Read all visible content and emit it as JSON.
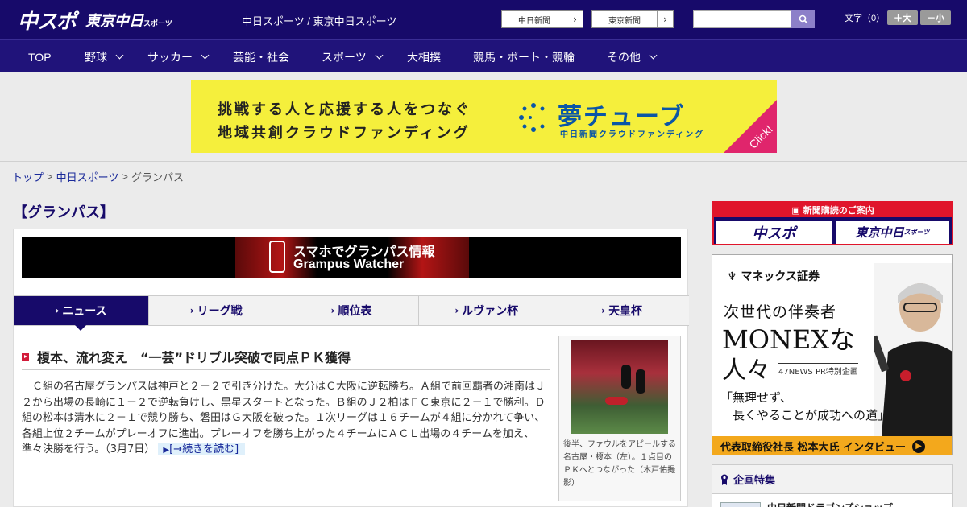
{
  "header": {
    "logo_main": "中スポ",
    "logo_tokyo": "東京中日",
    "logo_tokyo_sub": "スポーツ",
    "site_title": "中日スポーツ / 東京中日スポーツ",
    "links": [
      {
        "label": "中日新聞"
      },
      {
        "label": "東京新聞"
      }
    ],
    "search_placeholder": "",
    "font_size_label": "文字（0）",
    "font_bigger": "＋大",
    "font_smaller": "－小"
  },
  "nav": {
    "items": [
      {
        "label": "TOP"
      },
      {
        "label": "野球"
      },
      {
        "label": "サッカー"
      },
      {
        "label": "芸能・社会"
      },
      {
        "label": "スポーツ"
      },
      {
        "label": "大相撲"
      },
      {
        "label": "競馬・ボート・競輪"
      },
      {
        "label": "その他"
      }
    ]
  },
  "banner": {
    "line1": "挑戦する人と応援する人をつなぐ",
    "line2": "地域共創クラウドファンディング",
    "brand": "夢チューブ",
    "brand_sub": "中日新聞クラウドファンディング",
    "click": "Click!",
    "color": "#f5ef3c"
  },
  "breadcrumb": {
    "items": [
      "トップ",
      "中日スポーツ",
      "グランパス"
    ],
    "sep": ">"
  },
  "page": {
    "title": "【グランパス】",
    "watcher_line1": "スマホでグランパス情報",
    "watcher_line2": "Grampus Watcher"
  },
  "tabs": [
    {
      "label": "ニュース",
      "active": true
    },
    {
      "label": "リーグ戦"
    },
    {
      "label": "順位表"
    },
    {
      "label": "ルヴァン杯"
    },
    {
      "label": "天皇杯"
    }
  ],
  "article": {
    "headline": "榎本、流れ変え　“一芸”ドリブル突破で同点ＰＫ獲得",
    "body": "Ｃ組の名古屋グランパスは神戸と２－２で引き分けた。大分はＣ大阪に逆転勝ち。Ａ組で前回覇者の湘南はＪ２から出場の長崎に１－２で逆転負けし、黒星スタートとなった。Ｂ組のＪ２柏はＦＣ東京に２－１で勝利。Ｄ組の松本は清水に２－１で競り勝ち、磐田はＧ大阪を破った。１次リーグは１６チームが４組に分かれて争い、各組上位２チームがプレーオフに進出。プレーオフを勝ち上がった４チームにＡＣＬ出場の４チームを加え、準々決勝を行う。（3月7日）",
    "readmore": "[→続きを読む]",
    "photo_caption": "後半、ファウルをアピールする名古屋・榎本（左）。１点目のＰＫへとつながった（木戸佑撮影）"
  },
  "sidebar": {
    "subscribe_head": "新聞購読のご案内",
    "subscribe_a": "中スポ",
    "subscribe_b": "東京中日",
    "subscribe_b_sub": "スポーツ",
    "monex_logo": "マネックス証券",
    "monex_t1": "次世代の伴奏者",
    "monex_t2": "MONEXな",
    "monex_t3": "人々",
    "monex_pr": "47NEWS PR特別企画",
    "monex_quote1": "「無理せず、",
    "monex_quote2": "　長くやることが成功への道」",
    "monex_foot": "代表取締役社長 松本大氏 インタビュー",
    "kikaku_head": "企画特集",
    "kikaku_item": "中日新聞ドラゴンズショップ"
  },
  "colors": {
    "brand_navy": "#170a6a",
    "nav_navy": "#20137a",
    "accent_red": "#e0152b",
    "monex_orange": "#f3a81c"
  }
}
